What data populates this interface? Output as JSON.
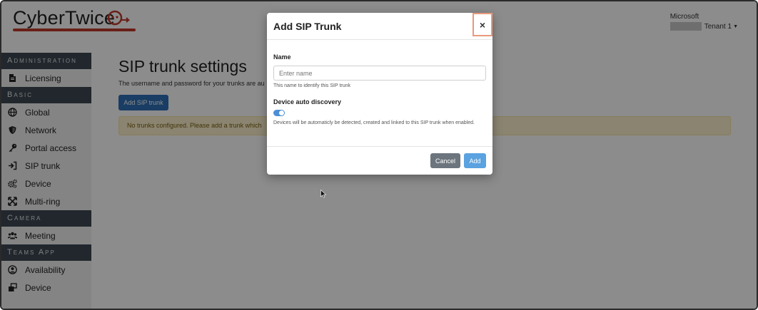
{
  "brand": {
    "name": "CyberTwice",
    "accent_color": "#c0392b"
  },
  "tenant": {
    "company": "Microsoft",
    "label": "Tenant 1"
  },
  "sidebar": {
    "sections": [
      {
        "title": "Administration",
        "items": [
          {
            "label": "Licensing",
            "icon": "file-icon"
          }
        ]
      },
      {
        "title": "Basic",
        "items": [
          {
            "label": "Global",
            "icon": "globe-icon"
          },
          {
            "label": "Network",
            "icon": "shield-icon"
          },
          {
            "label": "Portal access",
            "icon": "key-icon"
          },
          {
            "label": "SIP trunk",
            "icon": "sign-in-icon"
          },
          {
            "label": "Device",
            "icon": "gears-icon"
          },
          {
            "label": "Multi-ring",
            "icon": "expand-arrows-icon"
          }
        ]
      },
      {
        "title": "Camera",
        "items": [
          {
            "label": "Meeting",
            "icon": "users-icon"
          }
        ]
      },
      {
        "title": "Teams App",
        "items": [
          {
            "label": "Availability",
            "icon": "user-circle-icon"
          },
          {
            "label": "Device",
            "icon": "window-restore-icon"
          }
        ]
      }
    ]
  },
  "main": {
    "title": "SIP trunk settings",
    "description": "The username and password for your trunks are au",
    "add_button": "Add SIP trunk",
    "alert": "No trunks configured. Please add a trunk which"
  },
  "modal": {
    "title": "Add SIP Trunk",
    "close_label": "×",
    "name_label": "Name",
    "name_placeholder": "Enter name",
    "name_value": "",
    "name_help": "This name to identify this SIP trunk",
    "discovery_label": "Device auto discovery",
    "discovery_enabled": true,
    "discovery_help": "Devices will be automaticly be detected, created and linked to this SIP trunk when enabled.",
    "cancel_label": "Cancel",
    "add_label": "Add"
  }
}
